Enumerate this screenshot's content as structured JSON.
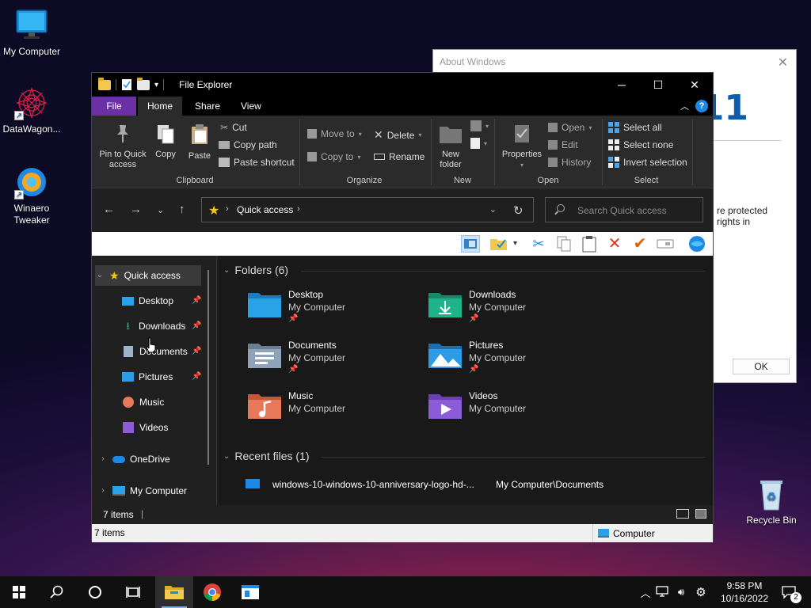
{
  "desktop": {
    "icons": [
      {
        "label": "My Computer"
      },
      {
        "label": "DataWagon..."
      },
      {
        "label": "Winaero Tweaker"
      },
      {
        "label": "Recycle Bin"
      }
    ]
  },
  "about_dialog": {
    "title": "About Windows",
    "version_big": "11",
    "text_line1": "re protected",
    "text_line2": "rights in",
    "ok_label": "OK"
  },
  "explorer": {
    "title": "File Explorer",
    "tabs": {
      "file": "File",
      "home": "Home",
      "share": "Share",
      "view": "View"
    },
    "ribbon": {
      "pin_label": "Pin to Quick access",
      "copy_label": "Copy",
      "paste_label": "Paste",
      "cut_label": "Cut",
      "copy_path_label": "Copy path",
      "paste_shortcut_label": "Paste shortcut",
      "clipboard_group": "Clipboard",
      "move_to_label": "Move to",
      "copy_to_label": "Copy to",
      "delete_label": "Delete",
      "rename_label": "Rename",
      "organize_group": "Organize",
      "new_folder_label": "New folder",
      "new_group": "New",
      "properties_label": "Properties",
      "open_label": "Open",
      "edit_label": "Edit",
      "history_label": "History",
      "open_group": "Open",
      "select_all_label": "Select all",
      "select_none_label": "Select none",
      "invert_selection_label": "Invert selection",
      "select_group": "Select"
    },
    "address": {
      "path": "Quick access",
      "search_placeholder": "Search Quick access"
    },
    "nav": {
      "quick_access": "Quick access",
      "items": [
        {
          "label": "Desktop"
        },
        {
          "label": "Downloads"
        },
        {
          "label": "Documents"
        },
        {
          "label": "Pictures"
        },
        {
          "label": "Music"
        },
        {
          "label": "Videos"
        }
      ],
      "onedrive": "OneDrive",
      "my_computer": "My Computer"
    },
    "content": {
      "folders_header": "Folders (6)",
      "folders": [
        {
          "name": "Desktop",
          "location": "My Computer",
          "color": "#29a3e8"
        },
        {
          "name": "Downloads",
          "location": "My Computer",
          "color": "#1fb38a"
        },
        {
          "name": "Documents",
          "location": "My Computer",
          "color": "#8fa3b8"
        },
        {
          "name": "Pictures",
          "location": "My Computer",
          "color": "#2e9be6"
        },
        {
          "name": "Music",
          "location": "My Computer",
          "color": "#e8785a"
        },
        {
          "name": "Videos",
          "location": "My Computer",
          "color": "#8b5cd6"
        }
      ],
      "recent_header": "Recent files (1)",
      "recent_files": [
        {
          "name": "windows-10-windows-10-anniversary-logo-hd-...",
          "path": "My Computer\\Documents"
        }
      ]
    },
    "status": {
      "items_count": "7 items",
      "items_count_bottom": "7 items",
      "computer_label": "Computer"
    }
  },
  "taskbar": {
    "time": "9:58 PM",
    "date": "10/16/2022",
    "notification_count": "2"
  }
}
